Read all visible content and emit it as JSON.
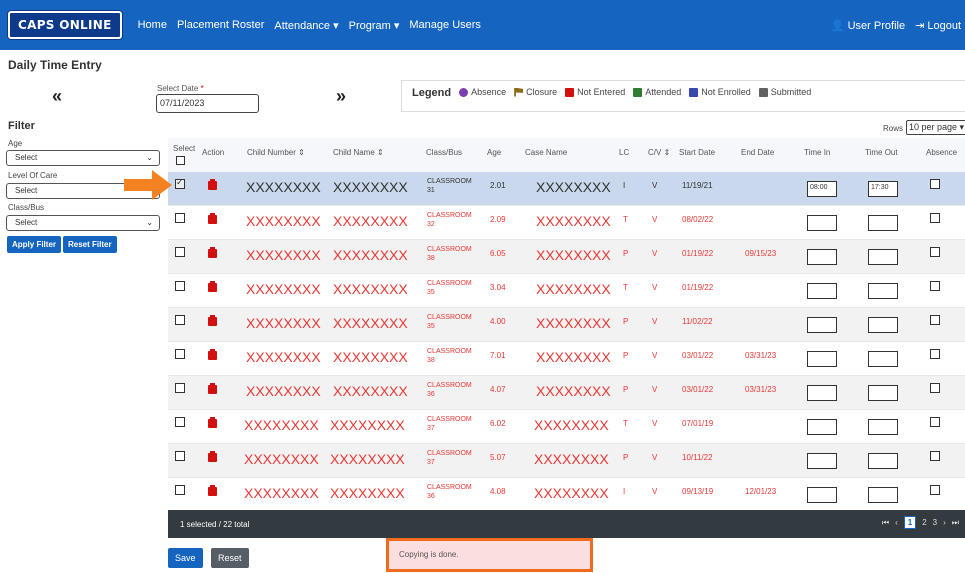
{
  "navbar": {
    "logo": "CAPS ONLINE",
    "items": [
      "Home",
      "Placement Roster",
      "Attendance ▾",
      "Program ▾",
      "Manage Users"
    ],
    "user_profile": "👤 User Profile",
    "logout": "⇥ Logout"
  },
  "page": {
    "title": "Daily Time Entry",
    "prev": "«",
    "next": "»"
  },
  "date": {
    "label": "Select Date",
    "required_mark": "*",
    "value": "07/11/2023"
  },
  "legend": {
    "title": "Legend",
    "items": [
      {
        "label": "Absence",
        "icon": "absence-icon"
      },
      {
        "label": "Closure",
        "icon": "flag-icon"
      },
      {
        "label": "Not Entered",
        "icon": "calendar-red-icon"
      },
      {
        "label": "Attended",
        "icon": "calendar-green-icon"
      },
      {
        "label": "Not Enrolled",
        "icon": "calendar-blue-icon"
      },
      {
        "label": "Submitted",
        "icon": "calendar-gray-icon"
      }
    ]
  },
  "filter": {
    "title": "Filter",
    "age_label": "Age",
    "age_value": "Select",
    "loc_label": "Level Of Care",
    "loc_value": "Select",
    "class_label": "Class/Bus",
    "class_value": "Select",
    "apply": "Apply Filter",
    "reset": "Reset Filter"
  },
  "rows_control": {
    "label": "Rows",
    "value": "10 per page ▾"
  },
  "table": {
    "headers": {
      "select": "Select",
      "action": "Action",
      "child_number": "Child Number ⇕",
      "child_name": "Child Name ⇕",
      "class_bus": "Class/Bus",
      "age": "Age",
      "case_name": "Case Name",
      "lc": "LC",
      "cv": "C/V ⇕",
      "start_date": "Start Date",
      "end_date": "End Date",
      "time_in": "Time In",
      "time_out": "Time Out",
      "absence": "Absence"
    },
    "rows": [
      {
        "child_number": "XXXXXXXX",
        "child_name": "XXXXXXXX",
        "class_a": "CLASSROOM",
        "class_b": "31",
        "age": "2.01",
        "case_name": "XXXXXXXX",
        "lc": "I",
        "cv": "V",
        "start_date": "11/19/21",
        "end_date": "",
        "time_in": "08:00",
        "time_out": "17:30"
      },
      {
        "child_number": "XXXXXXXX",
        "child_name": "XXXXXXXX",
        "class_a": "CLASSROOM",
        "class_b": "32",
        "age": "2.09",
        "case_name": "XXXXXXXX",
        "lc": "T",
        "cv": "V",
        "start_date": "08/02/22",
        "end_date": "",
        "time_in": "",
        "time_out": ""
      },
      {
        "child_number": "XXXXXXXX",
        "child_name": "XXXXXXXX",
        "class_a": "CLASSROOM",
        "class_b": "38",
        "age": "6.05",
        "case_name": "XXXXXXXX",
        "lc": "P",
        "cv": "V",
        "start_date": "01/19/22",
        "end_date": "09/15/23",
        "time_in": "",
        "time_out": ""
      },
      {
        "child_number": "XXXXXXXX",
        "child_name": "XXXXXXXX",
        "class_a": "CLASSROOM",
        "class_b": "35",
        "age": "3.04",
        "case_name": "XXXXXXXX",
        "lc": "T",
        "cv": "V",
        "start_date": "01/19/22",
        "end_date": "",
        "time_in": "",
        "time_out": ""
      },
      {
        "child_number": "XXXXXXXX",
        "child_name": "XXXXXXXX",
        "class_a": "CLASSROOM",
        "class_b": "35",
        "age": "4.00",
        "case_name": "XXXXXXXX",
        "lc": "P",
        "cv": "V",
        "start_date": "11/02/22",
        "end_date": "",
        "time_in": "",
        "time_out": ""
      },
      {
        "child_number": "XXXXXXXX",
        "child_name": "XXXXXXXX",
        "class_a": "CLASSROOM",
        "class_b": "38",
        "age": "7.01",
        "case_name": "XXXXXXXX",
        "lc": "P",
        "cv": "V",
        "start_date": "03/01/22",
        "end_date": "03/31/23",
        "time_in": "",
        "time_out": ""
      },
      {
        "child_number": "XXXXXXXX",
        "child_name": "XXXXXXXX",
        "class_a": "CLASSROOM",
        "class_b": "36",
        "age": "4.07",
        "case_name": "XXXXXXXX",
        "lc": "P",
        "cv": "V",
        "start_date": "03/01/22",
        "end_date": "03/31/23",
        "time_in": "",
        "time_out": ""
      },
      {
        "child_number": "XXXXXXXX",
        "child_name": "XXXXXXXX",
        "class_a": "CLASSROOM",
        "class_b": "37",
        "age": "6.02",
        "case_name": "XXXXXXXX",
        "lc": "T",
        "cv": "V",
        "start_date": "07/01/19",
        "end_date": "",
        "time_in": "",
        "time_out": ""
      },
      {
        "child_number": "XXXXXXXX",
        "child_name": "XXXXXXXX",
        "class_a": "CLASSROOM",
        "class_b": "37",
        "age": "5.07",
        "case_name": "XXXXXXXX",
        "lc": "P",
        "cv": "V",
        "start_date": "10/11/22",
        "end_date": "",
        "time_in": "",
        "time_out": ""
      },
      {
        "child_number": "XXXXXXXX",
        "child_name": "XXXXXXXX",
        "class_a": "CLASSROOM",
        "class_b": "36",
        "age": "4.08",
        "case_name": "XXXXXXXX",
        "lc": "I",
        "cv": "V",
        "start_date": "09/13/19",
        "end_date": "12/01/23",
        "time_in": "",
        "time_out": ""
      }
    ]
  },
  "footer": {
    "summary": "1 selected / 22 total",
    "first": "⏮",
    "prev": "‹",
    "pages": [
      "1",
      "2",
      "3"
    ],
    "next": "›",
    "last": "⏭"
  },
  "actions": {
    "save": "Save",
    "reset": "Reset"
  },
  "toast": {
    "message": "Copying is done."
  },
  "colors": {
    "brand": "#1565c0",
    "not_entered": "#d31010",
    "highlight": "#f26b1d"
  }
}
